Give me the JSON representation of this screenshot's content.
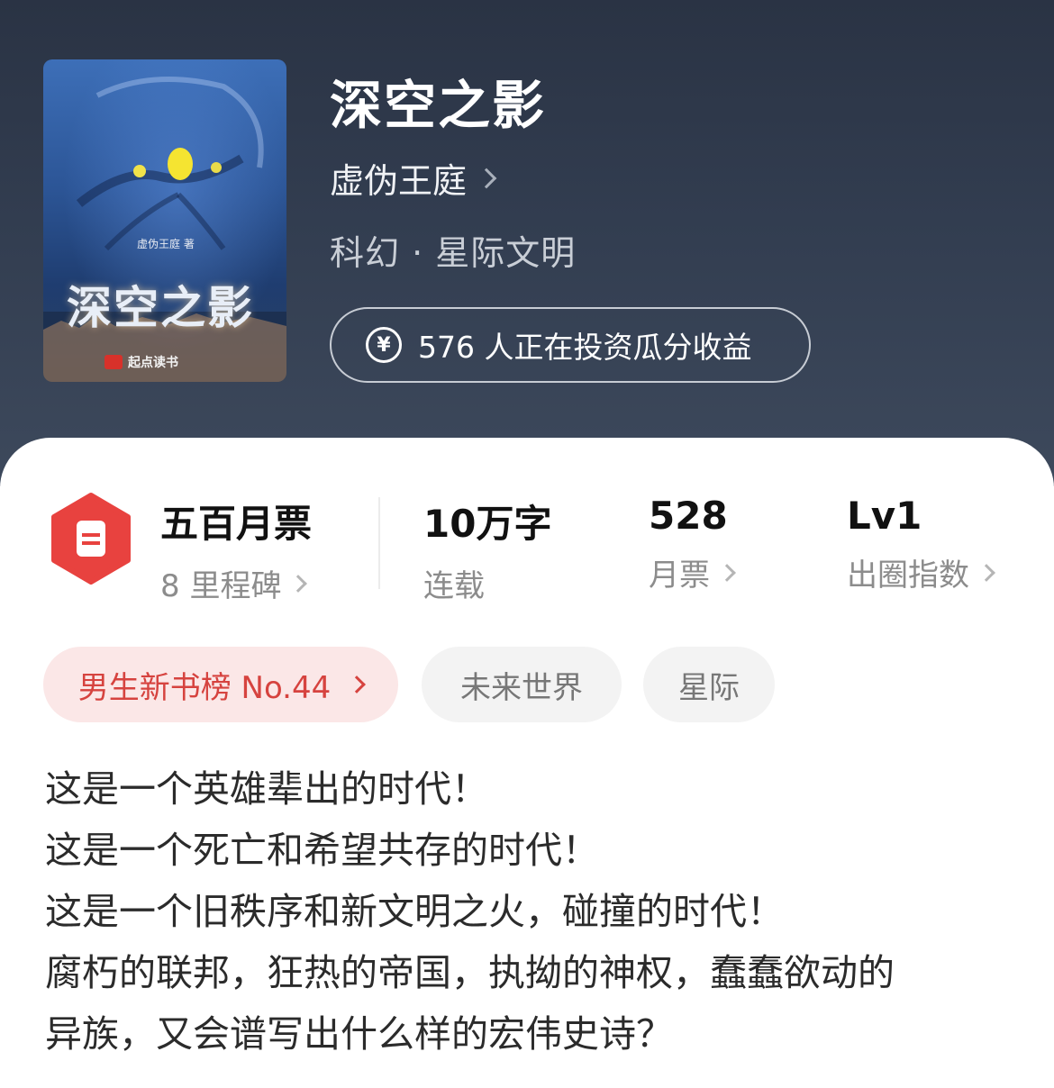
{
  "book": {
    "title": "深空之影",
    "author": "虚伪王庭",
    "genre": "科幻 · 星际文明",
    "invest_text": "576 人正在投资瓜分收益",
    "cover": {
      "title": "深空之影",
      "author_credit": "虚伪王庭 著",
      "publisher": "起点读书"
    }
  },
  "stats": [
    {
      "value": "五百月票",
      "label": "8 里程碑",
      "has_arrow": true
    },
    {
      "value": "10万字",
      "label": "连载",
      "has_arrow": false
    },
    {
      "value": "528",
      "label": "月票",
      "has_arrow": true
    },
    {
      "value": "Lv1",
      "label": "出圈指数",
      "has_arrow": true
    }
  ],
  "tags": [
    {
      "label": "男生新书榜 No.44",
      "highlight": true
    },
    {
      "label": "未来世界",
      "highlight": false
    },
    {
      "label": "星际",
      "highlight": false
    }
  ],
  "description": [
    "这是一个英雄辈出的时代！",
    "这是一个死亡和希望共存的时代！",
    "这是一个旧秩序和新文明之火，碰撞的时代！",
    "腐朽的联邦，狂热的帝国，执拗的神权，蠢蠢欲动的",
    "异族，又会谱写出什么样的宏伟史诗？"
  ],
  "colors": {
    "hero_bg": "#2f3a4c",
    "accent_red": "#e8423f",
    "rank_tag_bg": "#fbe7e7",
    "rank_tag_text": "#d6433f"
  },
  "icons": [
    "yen-icon",
    "ticket-icon",
    "chevron-right-icon"
  ]
}
